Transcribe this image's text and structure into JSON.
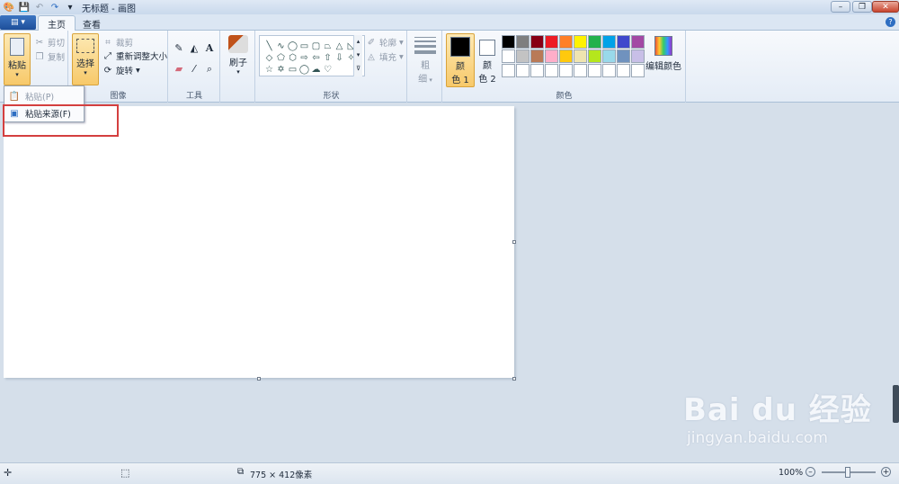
{
  "window": {
    "title": "无标题 - 画图"
  },
  "tabs": [
    {
      "label": "主页"
    },
    {
      "label": "查看"
    }
  ],
  "ribbon": {
    "clipboard": {
      "paste_label": "粘贴",
      "cut_label": "剪切",
      "copy_label": "复制"
    },
    "image": {
      "select_label": "选择",
      "crop_label": "裁剪",
      "resize_label": "重新调整大小",
      "rotate_label": "旋转",
      "group_label": "图像"
    },
    "tools": {
      "group_label": "工具"
    },
    "brushes": {
      "label": "刷子"
    },
    "shapes": {
      "outline_label": "轮廓",
      "fill_label": "填充",
      "group_label": "形状"
    },
    "size": {
      "label_line1": "粗",
      "label_line2": "细"
    },
    "colors": {
      "color1_line1": "颜",
      "color1_line2": "色 1",
      "color2_line1": "颜",
      "color2_line2": "色 2",
      "edit_label": "编辑颜色",
      "group_label": "颜色",
      "color1_value": "#000000",
      "color2_value": "#ffffff",
      "palette": [
        "#000000",
        "#7f7f7f",
        "#880015",
        "#ed1c24",
        "#ff7f27",
        "#fff200",
        "#22b14c",
        "#00a2e8",
        "#3f48cc",
        "#a349a4",
        "#ffffff",
        "#c3c3c3",
        "#b97a57",
        "#ffaec9",
        "#ffc90e",
        "#efe4b0",
        "#b5e61d",
        "#99d9ea",
        "#7092be",
        "#c8bfe7",
        "#ffffff",
        "#ffffff",
        "#ffffff",
        "#ffffff",
        "#ffffff",
        "#ffffff",
        "#ffffff",
        "#ffffff",
        "#ffffff",
        "#ffffff"
      ]
    }
  },
  "paste_menu": {
    "items": [
      {
        "label": "粘贴(P)",
        "enabled": false
      },
      {
        "label": "粘贴来源(F)",
        "enabled": true
      }
    ]
  },
  "status": {
    "dimensions": "775 × 412像素",
    "zoom": "100%"
  },
  "watermark": {
    "brand": "Bai du 经验",
    "url": "jingyan.baidu.com"
  }
}
